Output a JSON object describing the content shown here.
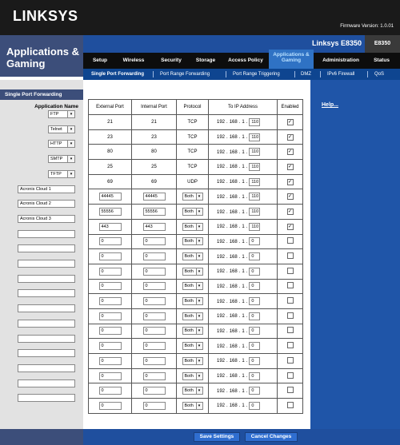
{
  "header": {
    "logo": "LINKSYS",
    "firmware": "Firmware Version: 1.0.01",
    "section_title_line1": "Applications &",
    "section_title_line2": "Gaming",
    "model_name": "Linksys E8350",
    "model_code": "E8350"
  },
  "tabs": [
    {
      "label": "Setup"
    },
    {
      "label": "Wireless"
    },
    {
      "label": "Security"
    },
    {
      "label": "Storage"
    },
    {
      "label": "Access Policy"
    },
    {
      "label": "Applications & Gaming",
      "line1": "Applications &",
      "line2": "Gaming"
    },
    {
      "label": "Administration"
    },
    {
      "label": "Status"
    }
  ],
  "subtabs": [
    {
      "label": "Single Port Forwarding"
    },
    {
      "label": "Port Range Forwarding"
    },
    {
      "label": "Port Range Triggering"
    },
    {
      "label": "DMZ"
    },
    {
      "label": "IPv6 Firewall"
    },
    {
      "label": "QoS"
    }
  ],
  "left": {
    "section_label": "Single Port Forwarding",
    "app_name_header": "Application Name"
  },
  "table_headers": {
    "external_port": "External Port",
    "internal_port": "Internal Port",
    "protocol": "Protocol",
    "to_ip": "To IP Address",
    "enabled": "Enabled"
  },
  "ip_sep": ".",
  "rows": [
    {
      "app": "FTP",
      "kind": "select",
      "ext": "21",
      "int": "21",
      "proto": "TCP",
      "ip": [
        "192",
        "168",
        "1",
        "110"
      ],
      "enabled": true
    },
    {
      "app": "Telnet",
      "kind": "select",
      "ext": "23",
      "int": "23",
      "proto": "TCP",
      "ip": [
        "192",
        "168",
        "1",
        "110"
      ],
      "enabled": true
    },
    {
      "app": "HTTP",
      "kind": "select",
      "ext": "80",
      "int": "80",
      "proto": "TCP",
      "ip": [
        "192",
        "168",
        "1",
        "110"
      ],
      "enabled": true
    },
    {
      "app": "SMTP",
      "kind": "select",
      "ext": "25",
      "int": "25",
      "proto": "TCP",
      "ip": [
        "192",
        "168",
        "1",
        "110"
      ],
      "enabled": true
    },
    {
      "app": "TFTP",
      "kind": "select",
      "ext": "69",
      "int": "69",
      "proto": "UDP",
      "ip": [
        "192",
        "168",
        "1",
        "110"
      ],
      "enabled": true
    },
    {
      "app": "Acronis Cloud 1",
      "kind": "input",
      "ext": "44445",
      "int": "44445",
      "proto": "Both",
      "ip": [
        "192",
        "168",
        "1",
        "110"
      ],
      "enabled": true
    },
    {
      "app": "Acronis Cloud 2",
      "kind": "input",
      "ext": "55556",
      "int": "55556",
      "proto": "Both",
      "ip": [
        "192",
        "168",
        "1",
        "110"
      ],
      "enabled": true
    },
    {
      "app": "Acronis Cloud 3",
      "kind": "input",
      "ext": "443",
      "int": "443",
      "proto": "Both",
      "ip": [
        "192",
        "168",
        "1",
        "110"
      ],
      "enabled": true
    },
    {
      "app": "",
      "kind": "input",
      "ext": "0",
      "int": "0",
      "proto": "Both",
      "ip": [
        "192",
        "168",
        "1",
        "0"
      ],
      "enabled": false
    },
    {
      "app": "",
      "kind": "input",
      "ext": "0",
      "int": "0",
      "proto": "Both",
      "ip": [
        "192",
        "168",
        "1",
        "0"
      ],
      "enabled": false
    },
    {
      "app": "",
      "kind": "input",
      "ext": "0",
      "int": "0",
      "proto": "Both",
      "ip": [
        "192",
        "168",
        "1",
        "0"
      ],
      "enabled": false
    },
    {
      "app": "",
      "kind": "input",
      "ext": "0",
      "int": "0",
      "proto": "Both",
      "ip": [
        "192",
        "168",
        "1",
        "0"
      ],
      "enabled": false
    },
    {
      "app": "",
      "kind": "input",
      "ext": "0",
      "int": "0",
      "proto": "Both",
      "ip": [
        "192",
        "168",
        "1",
        "0"
      ],
      "enabled": false
    },
    {
      "app": "",
      "kind": "input",
      "ext": "0",
      "int": "0",
      "proto": "Both",
      "ip": [
        "192",
        "168",
        "1",
        "0"
      ],
      "enabled": false
    },
    {
      "app": "",
      "kind": "input",
      "ext": "0",
      "int": "0",
      "proto": "Both",
      "ip": [
        "192",
        "168",
        "1",
        "0"
      ],
      "enabled": false
    },
    {
      "app": "",
      "kind": "input",
      "ext": "0",
      "int": "0",
      "proto": "Both",
      "ip": [
        "192",
        "168",
        "1",
        "0"
      ],
      "enabled": false
    },
    {
      "app": "",
      "kind": "input",
      "ext": "0",
      "int": "0",
      "proto": "Both",
      "ip": [
        "192",
        "168",
        "1",
        "0"
      ],
      "enabled": false
    },
    {
      "app": "",
      "kind": "input",
      "ext": "0",
      "int": "0",
      "proto": "Both",
      "ip": [
        "192",
        "168",
        "1",
        "0"
      ],
      "enabled": false
    },
    {
      "app": "",
      "kind": "input",
      "ext": "0",
      "int": "0",
      "proto": "Both",
      "ip": [
        "192",
        "168",
        "1",
        "0"
      ],
      "enabled": false
    },
    {
      "app": "",
      "kind": "input",
      "ext": "0",
      "int": "0",
      "proto": "Both",
      "ip": [
        "192",
        "168",
        "1",
        "0"
      ],
      "enabled": false
    }
  ],
  "right": {
    "help_link": "Help..."
  },
  "footer": {
    "save": "Save Settings",
    "cancel": "Cancel Changes"
  }
}
